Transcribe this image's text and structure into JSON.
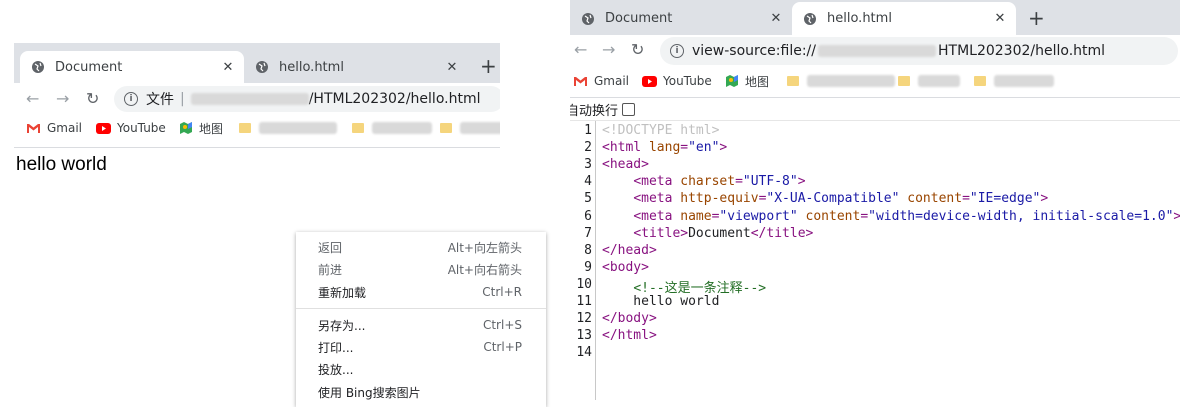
{
  "left_window": {
    "tabs": [
      {
        "title": "Document",
        "active": true
      },
      {
        "title": "hello.html",
        "active": false
      }
    ],
    "address": {
      "prefix": "文件",
      "path_visible": "/HTML202302/hello.html"
    },
    "bookmarks": [
      {
        "label": "Gmail",
        "icon": "gmail-icon"
      },
      {
        "label": "YouTube",
        "icon": "youtube-icon"
      },
      {
        "label": "地图",
        "icon": "maps-icon"
      }
    ],
    "content": {
      "text": "hello world"
    }
  },
  "context_menu": {
    "items": [
      {
        "label": "返回",
        "shortcut": "Alt+向左箭头",
        "enabled": false
      },
      {
        "label": "前进",
        "shortcut": "Alt+向右箭头",
        "enabled": false
      },
      {
        "label": "重新加载",
        "shortcut": "Ctrl+R",
        "enabled": true
      },
      {
        "label": "另存为...",
        "shortcut": "Ctrl+S",
        "enabled": true
      },
      {
        "label": "打印...",
        "shortcut": "Ctrl+P",
        "enabled": true
      },
      {
        "label": "投放...",
        "shortcut": "",
        "enabled": true
      },
      {
        "label": "使用 Bing搜索图片",
        "shortcut": "",
        "enabled": true
      }
    ]
  },
  "right_window": {
    "tabs": [
      {
        "title": "Document",
        "active": false
      },
      {
        "title": "hello.html",
        "active": true
      }
    ],
    "address": {
      "prefix": "view-source:file://",
      "path_visible": "HTML202302/hello.html"
    },
    "bookmarks": [
      {
        "label": "Gmail",
        "icon": "gmail-icon"
      },
      {
        "label": "YouTube",
        "icon": "youtube-icon"
      },
      {
        "label": "地图",
        "icon": "maps-icon"
      }
    ],
    "line_wrap_label": "自动换行",
    "source_lines": [
      {
        "n": "1",
        "text": "<!DOCTYPE html>"
      },
      {
        "n": "2",
        "text": "<html lang=\"en\">"
      },
      {
        "n": "3",
        "text": "<head>"
      },
      {
        "n": "4",
        "text": "    <meta charset=\"UTF-8\">"
      },
      {
        "n": "5",
        "text": "    <meta http-equiv=\"X-UA-Compatible\" content=\"IE=edge\">"
      },
      {
        "n": "6",
        "text": "    <meta name=\"viewport\" content=\"width=device-width, initial-scale=1.0\">"
      },
      {
        "n": "7",
        "text": "    <title>Document</title>"
      },
      {
        "n": "8",
        "text": "</head>"
      },
      {
        "n": "9",
        "text": "<body>"
      },
      {
        "n": "10",
        "text": "    <!--这是一条注释-->"
      },
      {
        "n": "11",
        "text": "    hello world"
      },
      {
        "n": "12",
        "text": "</body>"
      },
      {
        "n": "13",
        "text": "</html>"
      },
      {
        "n": "14",
        "text": ""
      }
    ]
  },
  "colors": {
    "tab_bar": "#dee1e6",
    "omnibox": "#f1f3f4",
    "tag": "#881280",
    "attr": "#994500",
    "value": "#1a1aa6",
    "comment": "#236e25"
  }
}
